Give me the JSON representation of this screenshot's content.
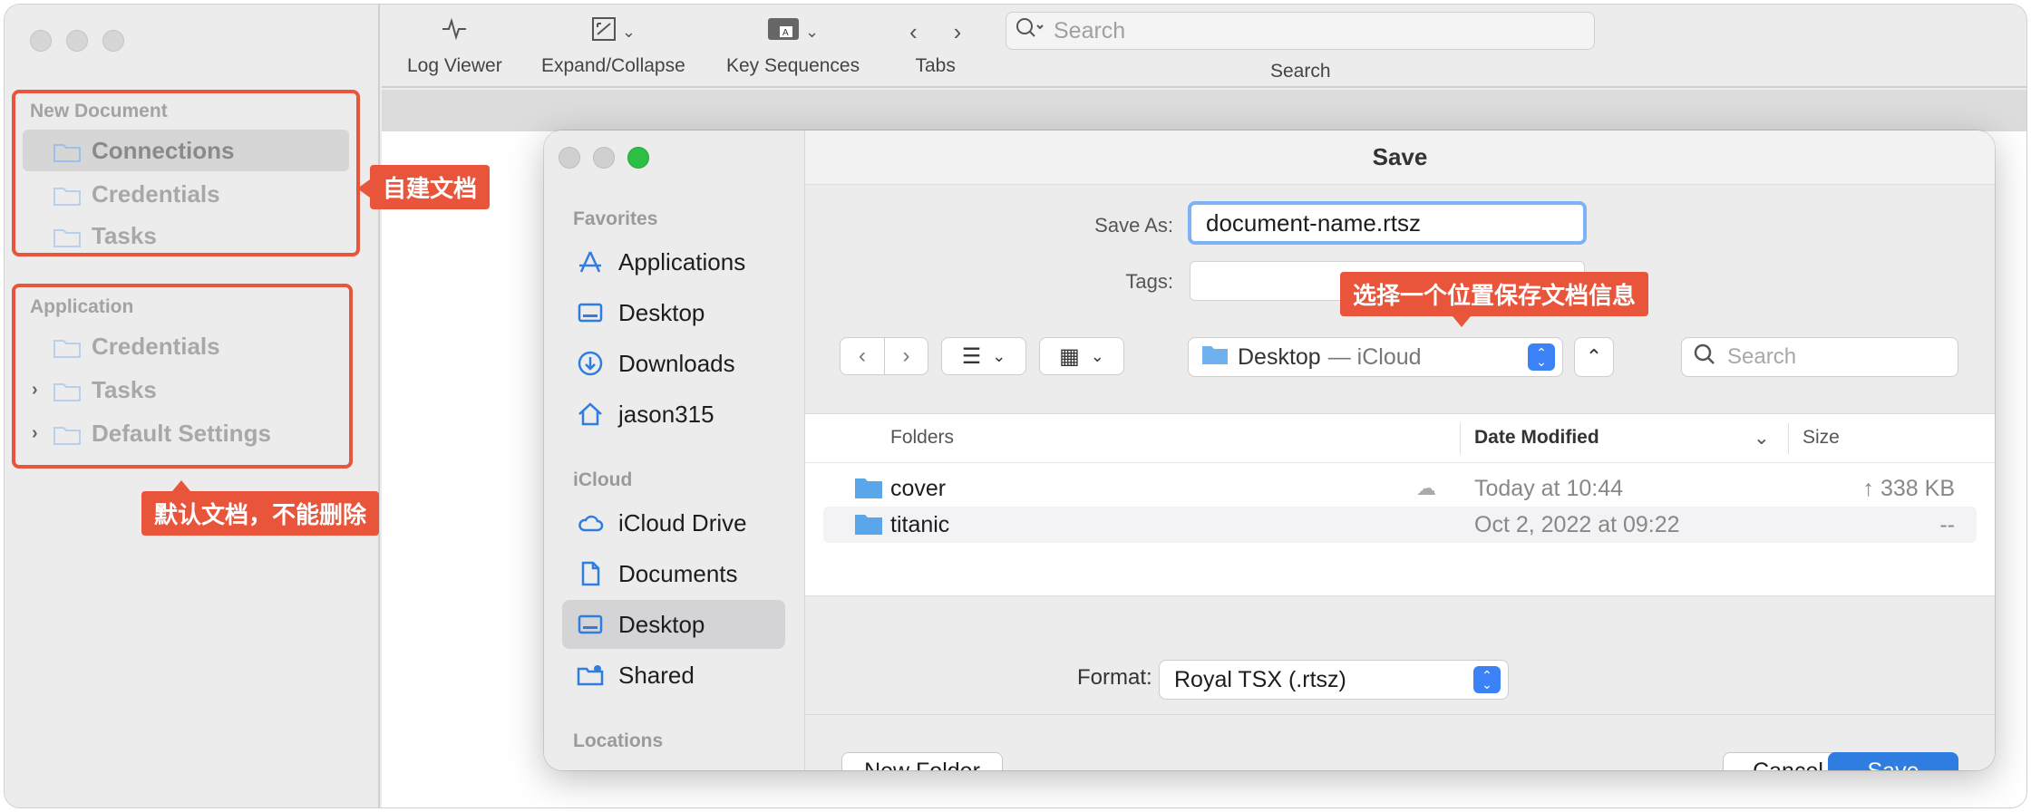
{
  "sidebar": {
    "groups": [
      {
        "heading": "New Document",
        "items": [
          "Connections",
          "Credentials",
          "Tasks"
        ]
      },
      {
        "heading": "Application",
        "items": [
          "Credentials",
          "Tasks",
          "Default Settings"
        ]
      }
    ]
  },
  "callouts": {
    "new_document": "自建文档",
    "default_docs": "默认文档，不能删除",
    "choose_location": "选择一个位置保存文档信息"
  },
  "toolbar": {
    "buttons": [
      "Log Viewer",
      "Expand/Collapse",
      "Key Sequences",
      "Tabs"
    ],
    "search_placeholder": "Search",
    "search_label": "Search"
  },
  "dialog": {
    "title": "Save",
    "save_as_label": "Save As:",
    "save_as_value": "document-name.rtsz",
    "tags_label": "Tags:",
    "location_name": "Desktop",
    "location_sub": "— iCloud",
    "search_placeholder": "Search",
    "sidebar": {
      "favorites_heading": "Favorites",
      "favorites": [
        "Applications",
        "Desktop",
        "Downloads",
        "jason315"
      ],
      "icloud_heading": "iCloud",
      "icloud": [
        "iCloud Drive",
        "Documents",
        "Desktop",
        "Shared"
      ],
      "locations_heading": "Locations"
    },
    "columns": {
      "name": "Folders",
      "date": "Date Modified",
      "size": "Size"
    },
    "rows": [
      {
        "name": "cover",
        "date": "Today at 10:44",
        "size": "↑ 338 KB"
      },
      {
        "name": "titanic",
        "date": "Oct 2, 2022 at 09:22",
        "size": "--"
      }
    ],
    "format_label": "Format:",
    "format_value": "Royal TSX (.rtsz)",
    "new_folder": "New Folder",
    "cancel": "Cancel",
    "save": "Save"
  },
  "colors": {
    "accent": "#2f7de1",
    "callout": "#e8553b"
  }
}
